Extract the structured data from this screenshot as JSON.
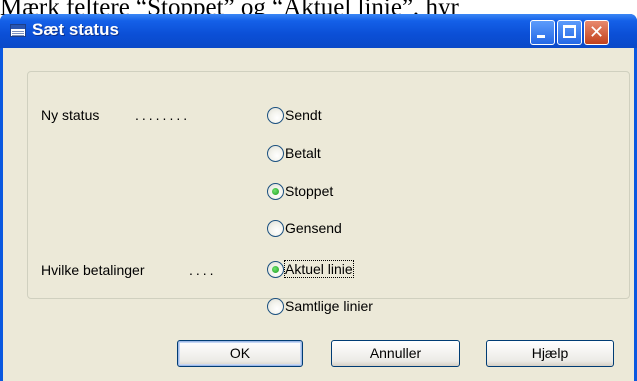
{
  "background_text": "Mærk feltere “Stoppet” og “Aktuel linie”, hyr",
  "window": {
    "title": "Sæt status",
    "controls": {
      "minimize": "minimize-icon",
      "maximize": "maximize-icon",
      "close": "close-icon",
      "close_glyph": "✕"
    }
  },
  "status": {
    "label": "Ny status",
    "dots": "........",
    "options": [
      {
        "label": "Sendt",
        "selected": false
      },
      {
        "label": "Betalt",
        "selected": false
      },
      {
        "label": "Stoppet",
        "selected": true
      },
      {
        "label": "Gensend",
        "selected": false
      }
    ]
  },
  "payments": {
    "label": "Hvilke betalinger",
    "dots": "....",
    "options": [
      {
        "label": "Aktuel linie",
        "selected": true
      },
      {
        "label": "Samtlige linier",
        "selected": false
      }
    ]
  },
  "buttons": {
    "ok": "OK",
    "cancel": "Annuller",
    "help": "Hjælp"
  }
}
